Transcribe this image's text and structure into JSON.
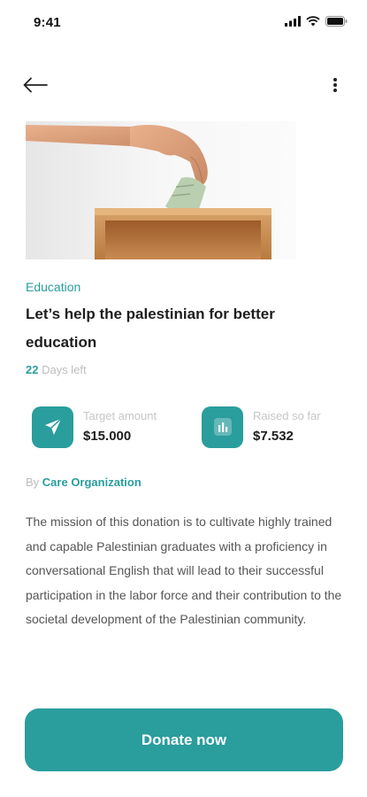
{
  "status_bar": {
    "time": "9:41"
  },
  "campaign": {
    "category": "Education",
    "title": "Let’s help the palestinian for better education",
    "days_left_number": "22",
    "days_left_label": " Days left",
    "target": {
      "label": "Target amount",
      "value": "$15.000",
      "icon": "send-icon"
    },
    "raised": {
      "label": "Raised so far",
      "value": "$7.532",
      "icon": "bar-chart-icon"
    },
    "by_prefix": "By ",
    "organization": "Care Organization",
    "description": "The mission of this donation is to cultivate highly trained and capable Palestinian graduates with a proficiency in conversational English that will lead to their successful participation in the labor force and their contribution to the societal development of the Palestinian community."
  },
  "actions": {
    "donate_label": "Donate now"
  },
  "icons": {
    "back": "arrow-left-icon",
    "more": "more-vertical-icon"
  },
  "colors": {
    "accent": "#2a9d9d",
    "muted": "#bdbdbd",
    "text": "#1e1e1e"
  }
}
